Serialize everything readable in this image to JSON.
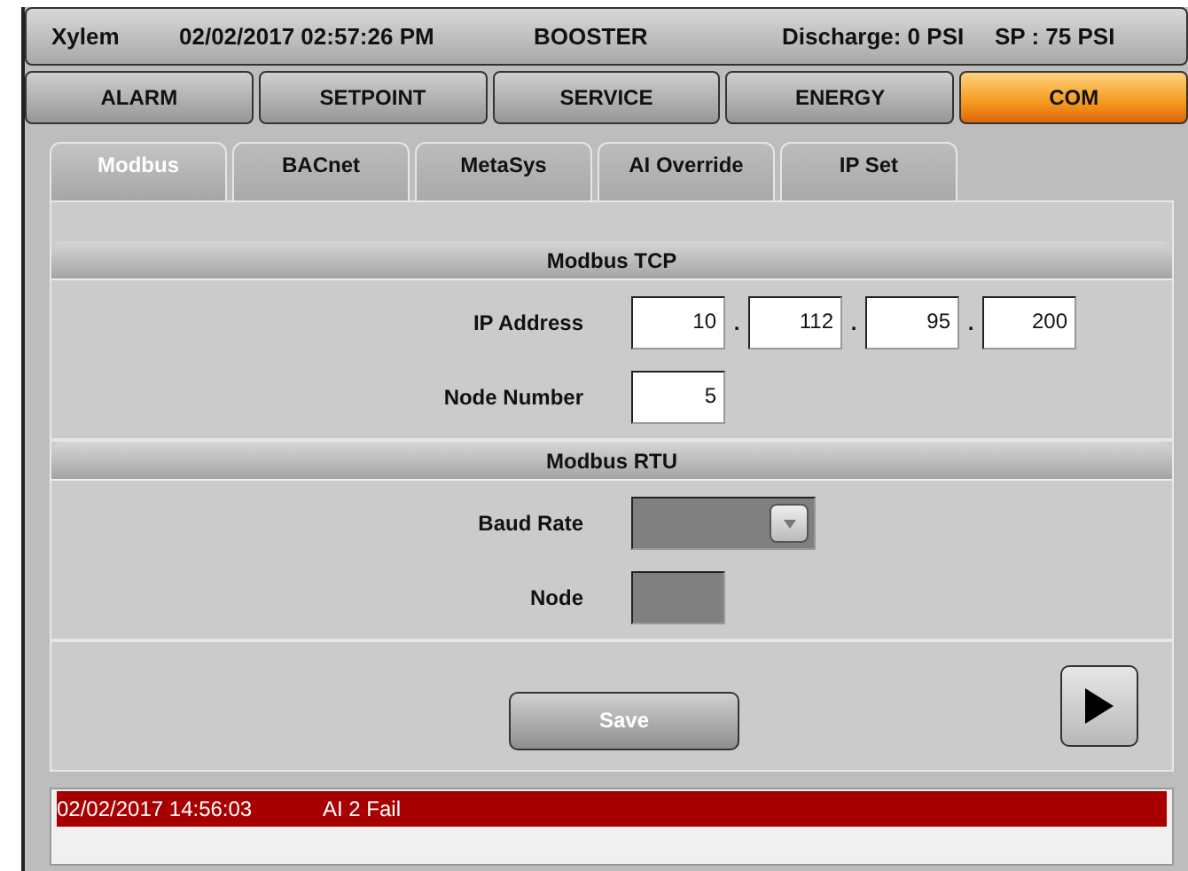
{
  "header": {
    "brand": "Xylem",
    "datetime": "02/02/2017 02:57:26 PM",
    "mode": "BOOSTER",
    "discharge": "Discharge: 0 PSI",
    "setpoint": "SP : 75 PSI"
  },
  "main_tabs": [
    {
      "label": "ALARM",
      "selected": false
    },
    {
      "label": "SETPOINT",
      "selected": false
    },
    {
      "label": "SERVICE",
      "selected": false
    },
    {
      "label": "ENERGY",
      "selected": false
    },
    {
      "label": "COM",
      "selected": true
    }
  ],
  "sub_tabs": [
    {
      "label": "Modbus",
      "selected": true
    },
    {
      "label": "BACnet",
      "selected": false
    },
    {
      "label": "MetaSys",
      "selected": false
    },
    {
      "label": "AI Override",
      "selected": false
    },
    {
      "label": "IP Set",
      "selected": false
    }
  ],
  "sections": [
    {
      "title": "Modbus TCP",
      "fields": [
        {
          "kind": "ip",
          "label": "IP Address",
          "octets": [
            "10",
            "112",
            "95",
            "200"
          ],
          "separators": [
            ".",
            ".",
            "."
          ]
        },
        {
          "kind": "number",
          "label": "Node Number",
          "value": "5",
          "disabled": false
        }
      ]
    },
    {
      "title": "Modbus RTU",
      "fields": [
        {
          "kind": "dropdown",
          "label": "Baud Rate",
          "disabled": true
        },
        {
          "kind": "number",
          "label": "Node",
          "disabled": true
        }
      ]
    }
  ],
  "save_button": "Save",
  "alarms": [
    {
      "time": "02/02/2017 14:56:03",
      "message": "AI 2 Fail",
      "active": true
    }
  ]
}
